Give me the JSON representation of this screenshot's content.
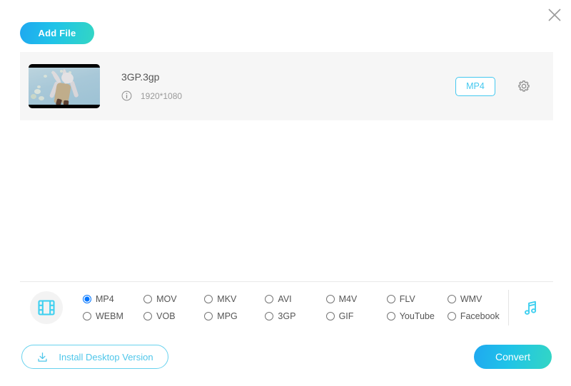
{
  "window": {
    "close_label": "×",
    "close_icon": "close-icon"
  },
  "toolbar": {
    "add_file_label": "Add File"
  },
  "file_list": [
    {
      "name": "3GP.3gp",
      "resolution": "1920*1080",
      "info_icon": "info-circle-icon",
      "output_format": "MP4",
      "settings_icon": "gear-icon",
      "thumbnail_alt": "stuffed-bunny-toy-thumbnail"
    }
  ],
  "format_panel": {
    "video_icon": "film-strip-icon",
    "audio_icon": "music-note-icon",
    "selected_format": "MP4",
    "options": [
      {
        "label": "MP4",
        "selected": true
      },
      {
        "label": "MOV",
        "selected": false
      },
      {
        "label": "MKV",
        "selected": false
      },
      {
        "label": "AVI",
        "selected": false
      },
      {
        "label": "M4V",
        "selected": false
      },
      {
        "label": "FLV",
        "selected": false
      },
      {
        "label": "WMV",
        "selected": false
      },
      {
        "label": "WEBM",
        "selected": false
      },
      {
        "label": "VOB",
        "selected": false
      },
      {
        "label": "MPG",
        "selected": false
      },
      {
        "label": "3GP",
        "selected": false
      },
      {
        "label": "GIF",
        "selected": false
      },
      {
        "label": "YouTube",
        "selected": false
      },
      {
        "label": "Facebook",
        "selected": false
      }
    ]
  },
  "footer": {
    "install_label": "Install Desktop Version",
    "install_icon": "download-icon",
    "convert_label": "Convert"
  },
  "colors": {
    "accent_cyan": "#45c8ef",
    "gradient_start": "#1fa8f0",
    "gradient_end": "#33d6c4",
    "row_background": "#f6f6f6",
    "radio_selected": "#1a73e8"
  }
}
